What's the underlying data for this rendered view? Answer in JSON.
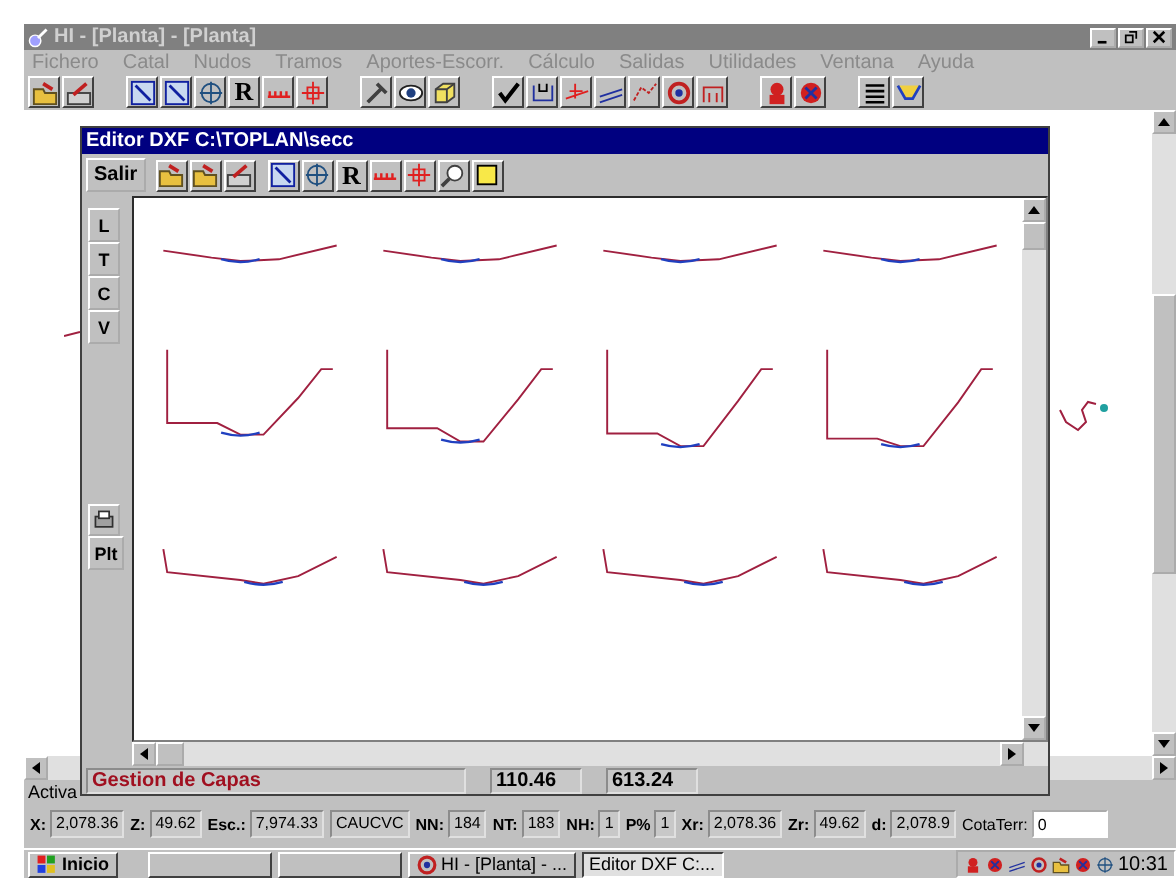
{
  "window": {
    "title": "HI - [Planta] - [Planta]",
    "active": false
  },
  "menu": [
    {
      "label": "Fichero",
      "disabled": true
    },
    {
      "label": "Catal",
      "disabled": true
    },
    {
      "label": "Nudos",
      "disabled": true
    },
    {
      "label": "Tramos",
      "disabled": true
    },
    {
      "label": "Aportes-Escorr.",
      "disabled": true
    },
    {
      "label": "Cálculo",
      "disabled": true
    },
    {
      "label": "Salidas",
      "disabled": true
    },
    {
      "label": "Utilidades",
      "disabled": true
    },
    {
      "label": "Ventana",
      "disabled": true
    },
    {
      "label": "Ayuda",
      "disabled": true
    }
  ],
  "toolbar": {
    "letter_button": "R"
  },
  "activar_label": "Activa",
  "editor": {
    "title": "Editor DXF C:\\TOPLAN\\secc",
    "active": true,
    "exit_button": "Salir",
    "letter_button": "R",
    "side_buttons": [
      "L",
      "T",
      "C",
      "V"
    ],
    "plot_button": "Plt",
    "status": {
      "layer_field": "Gestion de Capas",
      "value_1": "110.46",
      "value_2": "613.24"
    }
  },
  "status_bar": [
    {
      "label": "X:",
      "value": "2,078.36"
    },
    {
      "label": "Z:",
      "value": "49.62"
    },
    {
      "label": "Esc.:",
      "value": "7,974.33"
    },
    {
      "value": "CAUCVC"
    },
    {
      "label": "NN:",
      "value": "184"
    },
    {
      "label": "NT:",
      "value": "183"
    },
    {
      "label": "NH:",
      "value": "1"
    },
    {
      "label": "P%",
      "value": "1"
    },
    {
      "label": "Xr:",
      "value": "2,078.36"
    },
    {
      "label": "Zr:",
      "value": "49.62"
    },
    {
      "label": "d:",
      "value": "2,078.9"
    }
  ],
  "cota_terr": {
    "label": "CotaTerr:",
    "value": "0"
  },
  "taskbar": {
    "start": "Inicio",
    "tasks": [
      {
        "selected": false
      },
      {
        "selected": false
      },
      {
        "label": "HI - [Planta] - ...",
        "selected": false
      },
      {
        "label": "Editor DXF C:...",
        "selected": true
      }
    ],
    "clock": "10:31"
  }
}
